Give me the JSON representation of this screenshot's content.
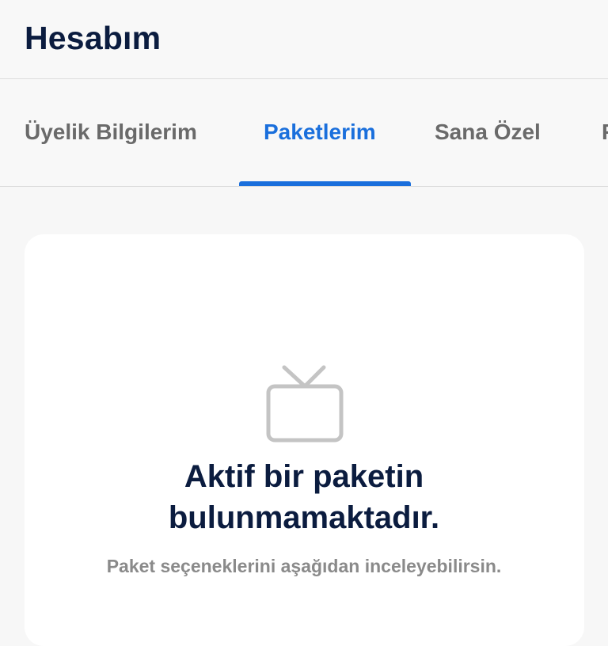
{
  "header": {
    "title": "Hesabım"
  },
  "tabs": [
    {
      "label": "Üyelik Bilgilerim",
      "active": false
    },
    {
      "label": "Paketlerim",
      "active": true
    },
    {
      "label": "Sana Özel",
      "active": false
    },
    {
      "label": "F",
      "active": false
    }
  ],
  "empty_state": {
    "icon": "tv-icon",
    "title_line1": "Aktif bir paketin",
    "title_line2": "bulunmamaktadır.",
    "subtitle": "Paket seçeneklerini aşağıdan inceleyebilirsin."
  },
  "colors": {
    "accent": "#1a6fdc",
    "title": "#0b1c3f",
    "tab_inactive": "#6a6a6a",
    "muted": "#8a8a8a",
    "background": "#f7f7f7",
    "card": "#ffffff"
  }
}
